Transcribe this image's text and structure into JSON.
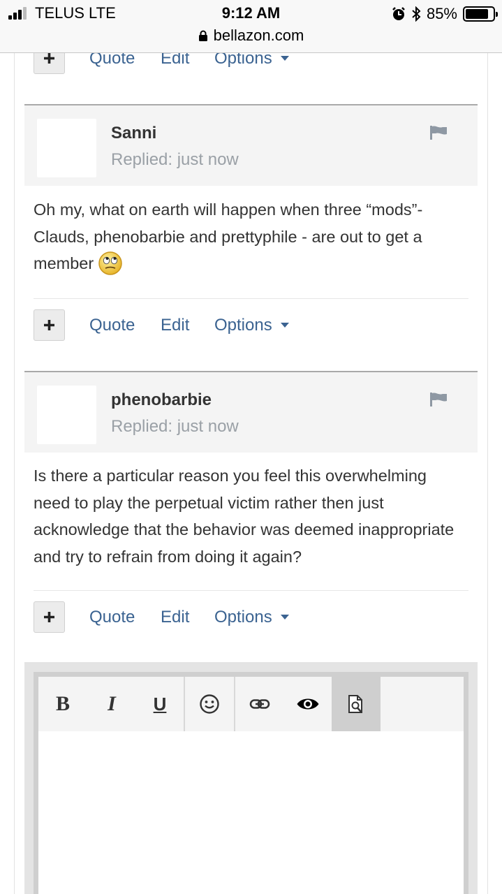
{
  "status_bar": {
    "carrier": "TELUS  LTE",
    "time": "9:12 AM",
    "battery_percent": "85%",
    "battery_level": 0.85,
    "url": "bellazon.com"
  },
  "top_actions": {
    "quote": "Quote",
    "edit": "Edit",
    "options": "Options"
  },
  "posts": [
    {
      "author": "Sanni",
      "replied": "Replied: just now",
      "body": "Oh my, what on earth will happen when three “mods”-  Clauds, phenobarbie and prettyphile -  are out to get a member",
      "emoji": "rolling-eyes-emoji",
      "actions": {
        "quote": "Quote",
        "edit": "Edit",
        "options": "Options"
      }
    },
    {
      "author": "phenobarbie",
      "replied": "Replied: just now",
      "body": "Is there a particular reason you feel this overwhelming need to play the perpetual victim rather then just acknowledge that the behavior was deemed inappropriate and try to refrain from doing it again?",
      "actions": {
        "quote": "Quote",
        "edit": "Edit",
        "options": "Options"
      }
    }
  ],
  "editor": {
    "bold": "B",
    "italic": "I",
    "underline": "U",
    "icons": [
      "smiley-icon",
      "link-icon",
      "eye-icon",
      "source-preview-icon"
    ]
  },
  "colors": {
    "link": "#3b6391",
    "post_header_bg": "#f4f4f4",
    "muted_text": "#9aa0a6"
  }
}
